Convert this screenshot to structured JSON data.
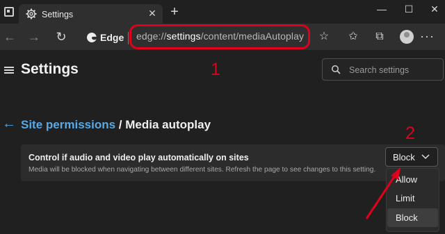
{
  "tab": {
    "title": "Settings",
    "close": "✕",
    "new_tab": "+"
  },
  "window_controls": {
    "minimize": "—",
    "maximize": "☐",
    "close": "✕"
  },
  "address_bar": {
    "brand": "Edge",
    "url_prefix": "edge://",
    "url_strong": "settings",
    "url_suffix": "/content/mediaAutoplay"
  },
  "settings": {
    "title": "Settings",
    "search_placeholder": "Search settings"
  },
  "breadcrumb": {
    "parent": "Site permissions",
    "separator": " / ",
    "current": "Media autoplay"
  },
  "setting_card": {
    "title": "Control if audio and video play automatically on sites",
    "description": "Media will be blocked when navigating between different sites. Refresh the page to see changes to this setting.",
    "selected_value": "Block"
  },
  "dropdown": {
    "options": [
      "Allow",
      "Limit",
      "Block"
    ],
    "selected": "Block"
  },
  "annotations": {
    "step1": "1",
    "step2": "2"
  },
  "colors": {
    "annotation_red": "#e0001b",
    "link_blue": "#58a9e6",
    "background": "#202020"
  },
  "icons": [
    "settings-gear-icon",
    "back-icon",
    "forward-icon",
    "refresh-icon",
    "edge-logo-icon",
    "add-favorite-icon",
    "favorites-icon",
    "collections-icon",
    "profile-avatar",
    "more-icon",
    "hamburger-menu-icon",
    "search-icon",
    "back-arrow-icon",
    "chevron-down-icon"
  ]
}
